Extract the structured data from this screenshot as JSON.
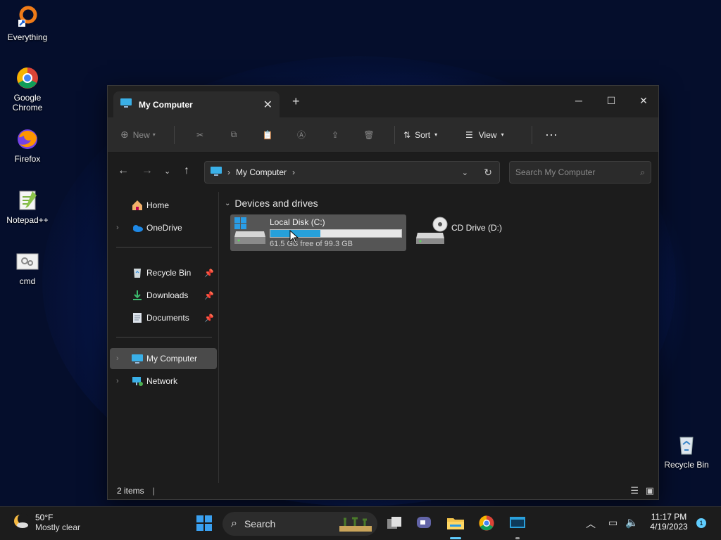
{
  "desktop": {
    "icons": [
      {
        "label": "Everything"
      },
      {
        "label": "Google Chrome"
      },
      {
        "label": "Firefox"
      },
      {
        "label": "Notepad++"
      },
      {
        "label": "cmd"
      },
      {
        "label": "Recycle Bin"
      }
    ]
  },
  "window": {
    "tab_title": "My Computer",
    "toolbar": {
      "new_label": "New",
      "sort_label": "Sort",
      "view_label": "View"
    },
    "address": {
      "path": "My Computer"
    },
    "search": {
      "placeholder": "Search My Computer"
    },
    "nav": [
      {
        "label": "Home"
      },
      {
        "label": "OneDrive"
      },
      {
        "label": "Recycle Bin"
      },
      {
        "label": "Downloads"
      },
      {
        "label": "Documents"
      },
      {
        "label": "My Computer"
      },
      {
        "label": "Network"
      }
    ],
    "group_header": "Devices and drives",
    "drives": [
      {
        "name": "Local Disk (C:)",
        "free_text": "61.5 GB free of 99.3 GB",
        "used_fraction": 0.38
      },
      {
        "name": "CD Drive (D:)"
      }
    ],
    "status": {
      "items": "2 items"
    }
  },
  "taskbar": {
    "weather_temp": "50°F",
    "weather_desc": "Mostly clear",
    "search_label": "Search",
    "time": "11:17 PM",
    "date": "4/19/2023",
    "notification_count": "1"
  },
  "colors": {
    "accent": "#26a0da",
    "window_bg": "#1c1c1c"
  }
}
